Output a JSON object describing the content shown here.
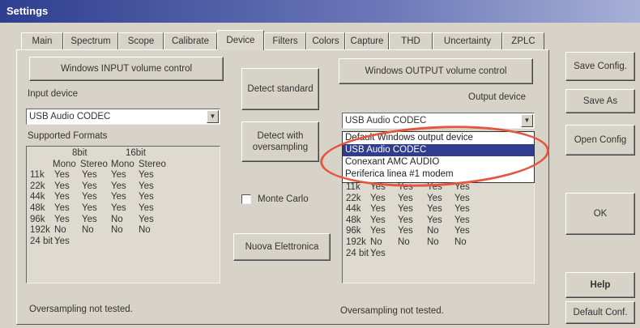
{
  "window": {
    "title": "Settings"
  },
  "tabs": [
    "Main",
    "Spectrum",
    "Scope",
    "Calibrate",
    "Device",
    "Filters",
    "Colors",
    "Capture",
    "THD",
    "Uncertainty",
    "ZPLC"
  ],
  "active_tab": "Device",
  "left": {
    "input_volume_button": "Windows INPUT volume control",
    "input_device_label": "Input device",
    "input_device_value": "USB Audio CODEC",
    "supported_formats_label": "Supported Formats",
    "formats_header1": [
      "8bit",
      "16bit"
    ],
    "formats_header2": [
      "Mono",
      "Stereo",
      "Mono",
      "Stereo"
    ],
    "formats_rows": [
      [
        "11k",
        "Yes",
        "Yes",
        "Yes",
        "Yes"
      ],
      [
        "22k",
        "Yes",
        "Yes",
        "Yes",
        "Yes"
      ],
      [
        "44k",
        "Yes",
        "Yes",
        "Yes",
        "Yes"
      ],
      [
        "48k",
        "Yes",
        "Yes",
        "Yes",
        "Yes"
      ],
      [
        "96k",
        "Yes",
        "Yes",
        "No",
        "Yes"
      ],
      [
        "192k",
        "No",
        "No",
        "No",
        "No"
      ],
      [
        "24 bit :",
        "Yes",
        "",
        "",
        ""
      ]
    ],
    "oversampling_status": "Oversampling not tested."
  },
  "middle": {
    "detect_standard": "Detect standard",
    "detect_oversampling": "Detect with oversampling",
    "monte_carlo": "Monte Carlo",
    "monte_carlo_checked": false,
    "nuova_elettronica": "Nuova Elettronica"
  },
  "right": {
    "output_volume_button": "Windows OUTPUT volume control",
    "output_device_label": "Output device",
    "output_device_value": "USB Audio CODEC",
    "dropdown_options": [
      "Default Windows output device",
      "USB Audio CODEC",
      "Conexant AMC AUDIO",
      "Periferica linea #1 modem"
    ],
    "dropdown_selected_index": 1,
    "formats_rows": [
      [
        "11k",
        "Yes",
        "Yes",
        "Yes",
        "Yes"
      ],
      [
        "22k",
        "Yes",
        "Yes",
        "Yes",
        "Yes"
      ],
      [
        "44k",
        "Yes",
        "Yes",
        "Yes",
        "Yes"
      ],
      [
        "48k",
        "Yes",
        "Yes",
        "Yes",
        "Yes"
      ],
      [
        "96k",
        "Yes",
        "Yes",
        "No",
        "Yes"
      ],
      [
        "192k",
        "No",
        "No",
        "No",
        "No"
      ],
      [
        "24 bit :",
        "Yes",
        "",
        "",
        ""
      ]
    ],
    "oversampling_status": "Oversampling not tested."
  },
  "side_buttons": {
    "save_config": "Save Config.",
    "save_as": "Save As",
    "open_config": "Open Config",
    "ok": "OK",
    "help": "Help",
    "default_conf": "Default Conf."
  },
  "colors": {
    "window_bg": "#d8d3c8",
    "titlebar": "#2e3f8f",
    "selection": "#2f3d8c",
    "highlight_ellipse": "#e4563f"
  }
}
